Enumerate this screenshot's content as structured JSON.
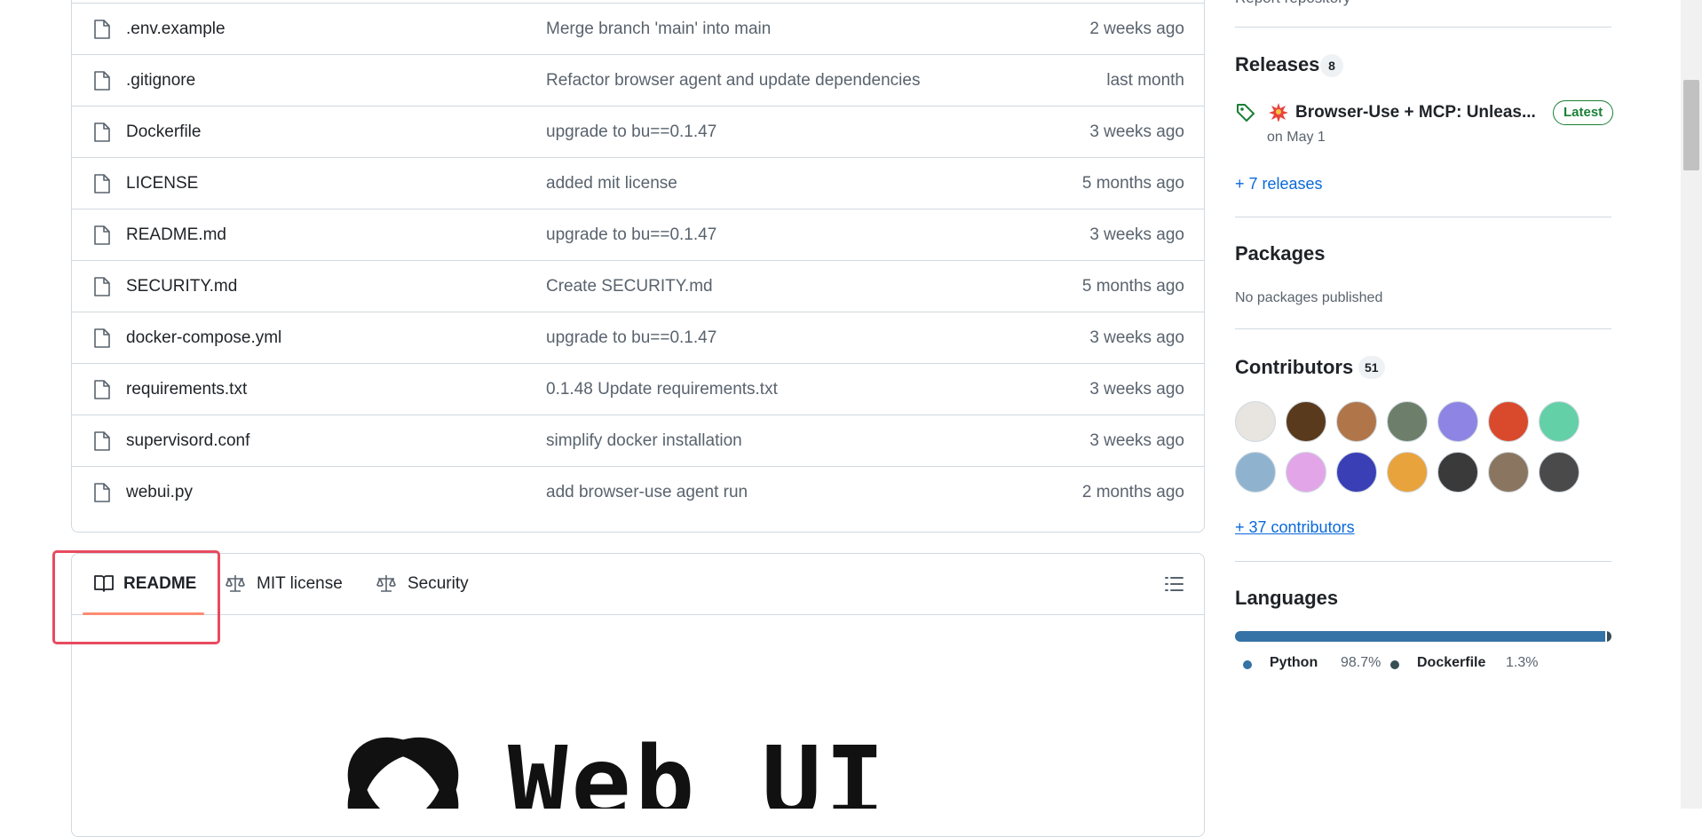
{
  "files": [
    {
      "name": "",
      "message": "",
      "age": ""
    },
    {
      "name": ".env.example",
      "message": "Merge branch 'main' into main",
      "age": "2 weeks ago"
    },
    {
      "name": ".gitignore",
      "message": "Refactor browser agent and update dependencies",
      "age": "last month"
    },
    {
      "name": "Dockerfile",
      "message": "upgrade to bu==0.1.47",
      "age": "3 weeks ago"
    },
    {
      "name": "LICENSE",
      "message": "added mit license",
      "age": "5 months ago"
    },
    {
      "name": "README.md",
      "message": "upgrade to bu==0.1.47",
      "age": "3 weeks ago"
    },
    {
      "name": "SECURITY.md",
      "message": "Create SECURITY.md",
      "age": "5 months ago"
    },
    {
      "name": "docker-compose.yml",
      "message": "upgrade to bu==0.1.47",
      "age": "3 weeks ago"
    },
    {
      "name": "requirements.txt",
      "message": "0.1.48 Update requirements.txt",
      "age": "3 weeks ago"
    },
    {
      "name": "supervisord.conf",
      "message": "simplify docker installation",
      "age": "3 weeks ago"
    },
    {
      "name": "webui.py",
      "message": "add browser-use agent run",
      "age": "2 months ago"
    }
  ],
  "readme": {
    "tabs": [
      {
        "label": "README",
        "icon": "book-icon",
        "active": true
      },
      {
        "label": "MIT license",
        "icon": "scale-icon",
        "active": false
      },
      {
        "label": "Security",
        "icon": "scale-icon",
        "active": false
      }
    ],
    "outline_icon": "list-icon",
    "logo_text": "Web UI",
    "active_tab_color": "#fd8c73",
    "highlight_color": "#e84a5f"
  },
  "sidebar": {
    "report_link": "Report repository",
    "releases": {
      "heading": "Releases",
      "count": "8",
      "latest_title": "Browser-Use + MCP: Unleas...",
      "latest_badge": "Latest",
      "latest_date": "on May 1",
      "more_link": "+ 7 releases"
    },
    "packages": {
      "heading": "Packages",
      "text": "No packages published"
    },
    "contributors": {
      "heading": "Contributors",
      "count": "51",
      "more_link": "+ 37 contributors",
      "avatars": [
        {
          "color": "#e8e4e0"
        },
        {
          "color": "#5a3a1c"
        },
        {
          "color": "#b0764a"
        },
        {
          "color": "#6d7f6a"
        },
        {
          "color": "#8d84e3"
        },
        {
          "color": "#d94a2c"
        },
        {
          "color": "#63d0a8"
        },
        {
          "color": "#8fb3cf"
        },
        {
          "color": "#e2a6e8"
        },
        {
          "color": "#3a3fb5"
        },
        {
          "color": "#e8a33c"
        },
        {
          "color": "#3a3a3a"
        },
        {
          "color": "#8a7660"
        },
        {
          "color": "#4a4a4a"
        }
      ]
    },
    "languages": {
      "heading": "Languages",
      "items": [
        {
          "name": "Python",
          "percent": "98.7%",
          "value": 98.7,
          "color": "#3572A5"
        },
        {
          "name": "Dockerfile",
          "percent": "1.3%",
          "value": 1.3,
          "color": "#384d54"
        }
      ]
    }
  }
}
